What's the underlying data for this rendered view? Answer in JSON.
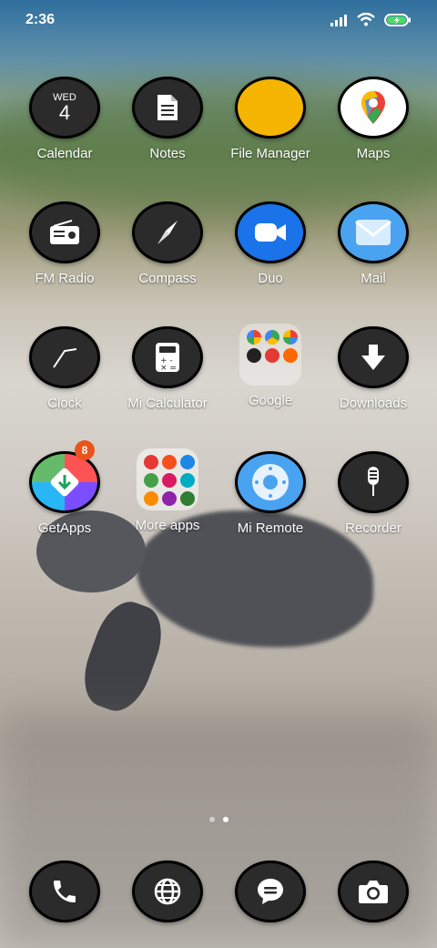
{
  "status_bar": {
    "time": "2:36"
  },
  "colors": {
    "file_manager_yellow": "#f4b400",
    "badge_orange": "#e8541c",
    "duo_blue": "#1a73e8",
    "mail_blue": "#4aa3f0"
  },
  "calendar_icon": {
    "weekday": "WED",
    "day": "4"
  },
  "apps": {
    "calendar": "Calendar",
    "notes": "Notes",
    "file_manager": "File Manager",
    "maps": "Maps",
    "fm_radio": "FM Radio",
    "compass": "Compass",
    "duo": "Duo",
    "mail": "Mail",
    "clock": "Clock",
    "mi_calculator": "Mi Calculator",
    "google": "Google",
    "downloads": "Downloads",
    "getapps": "GetApps",
    "more_apps": "More apps",
    "mi_remote": "Mi Remote",
    "recorder": "Recorder"
  },
  "getapps_badge": "8",
  "pages": {
    "count": 2,
    "current": 2
  },
  "dock": [
    "phone-icon",
    "browser-icon",
    "messages-icon",
    "camera-icon"
  ]
}
